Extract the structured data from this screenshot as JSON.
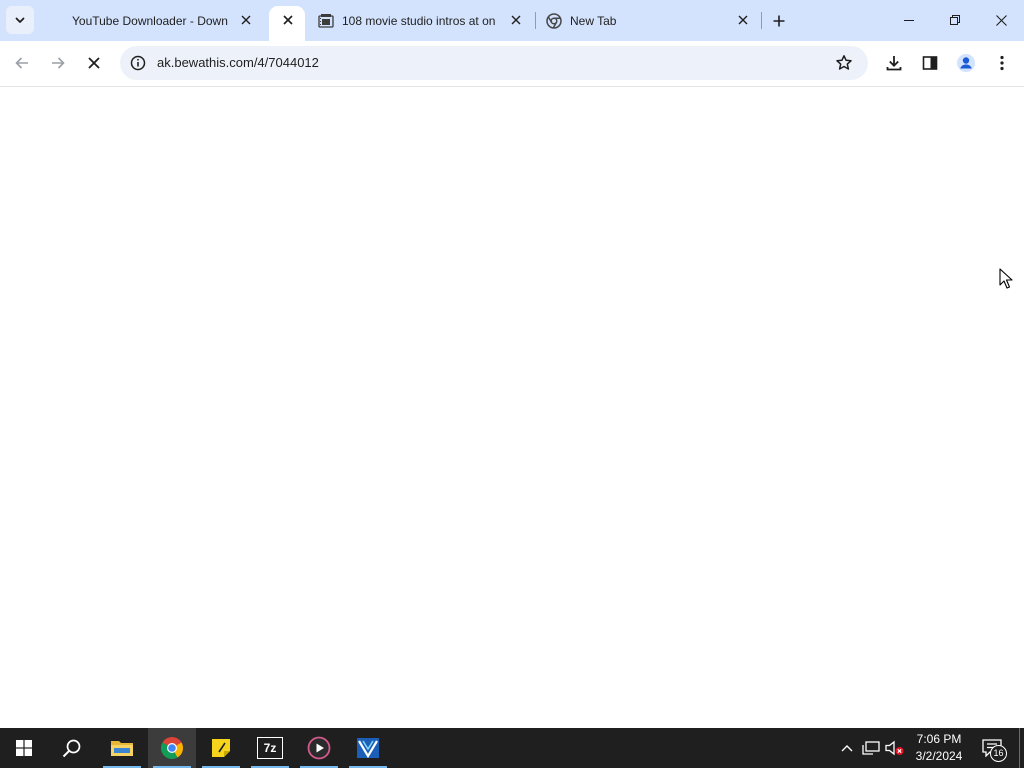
{
  "browser": {
    "tabs": [
      {
        "title": "YouTube Downloader - Downl",
        "icon": "none"
      },
      {
        "title": "",
        "icon": "none",
        "active": true
      },
      {
        "title": "108 movie studio intros at on",
        "icon": "film-icon"
      },
      {
        "title": "New Tab",
        "icon": "chrome-icon"
      }
    ],
    "address_bar": {
      "url": "ak.bewathis.com/4/7044012"
    }
  },
  "taskbar": {
    "apps": [
      "start",
      "search",
      "file-explorer",
      "chrome",
      "sticky-notes",
      "7-zip",
      "media-player",
      "app"
    ],
    "seven_zip_label": "7z",
    "clock": {
      "time": "7:06 PM",
      "date": "3/2/2024"
    },
    "notifications_count": "16"
  },
  "colors": {
    "tabstrip": "#d3e3fd",
    "omnibox": "#edf2fa",
    "taskbar": "#1f1f1f"
  }
}
